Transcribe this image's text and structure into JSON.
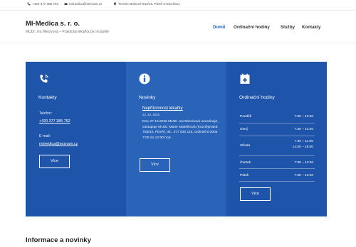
{
  "topbar": {
    "phone": "+420 377 385 752",
    "email": "mimedica@seznam.cz",
    "address": "Terezie Brzkové 942/16, Plzeň 3-Skvrňany"
  },
  "header": {
    "brand": "MI-Medica s. r. o.",
    "tagline": "MUDr. Iva Mlezivová – Praktická lékařka pro dospělé",
    "nav": [
      {
        "label": "Domů",
        "active": true
      },
      {
        "label": "Ordinační hodiny",
        "active": false
      },
      {
        "label": "Služby",
        "active": false
      },
      {
        "label": "Kontakty",
        "active": false
      }
    ]
  },
  "contacts": {
    "icon": "phone-signal-icon",
    "title": "Kontakty",
    "phone_label": "Telefon:",
    "phone": "+420 377 385 752",
    "email_label": "E-mail:",
    "email": "mimedica@seznam.cz",
    "more": "Více"
  },
  "news": {
    "icon": "info-icon",
    "title": "Novinky",
    "item_title": "Nepřítomnost lékařky",
    "item_date": "23. 10. 2025",
    "item_text": "Dne 27.10.2025 MUDr. Iva Mlezivová neordinuje, zastupuje MUDr. Marie Maletíková (Koznějovská 758/43, Plzeň), tel.: 377 530 116, ordinační doba 7:00 do 12:00 hod.",
    "more": "Více"
  },
  "hours": {
    "icon": "calendar-plus-icon",
    "title": "Ordinační hodiny",
    "rows": [
      {
        "day": "Pondělí",
        "time1": "7:30 – 13:30",
        "time2": ""
      },
      {
        "day": "Úterý",
        "time1": "7:30 – 13:30",
        "time2": ""
      },
      {
        "day": "Středa",
        "time1": "7:30 – 11:00",
        "time2": "14:00 – 18:00"
      },
      {
        "day": "Čtvrtek",
        "time1": "7:30 – 13:30",
        "time2": ""
      },
      {
        "day": "Pátek",
        "time1": "7:30 – 13:30",
        "time2": ""
      }
    ],
    "more": "Více"
  },
  "section": {
    "title": "Informace a novinky"
  }
}
